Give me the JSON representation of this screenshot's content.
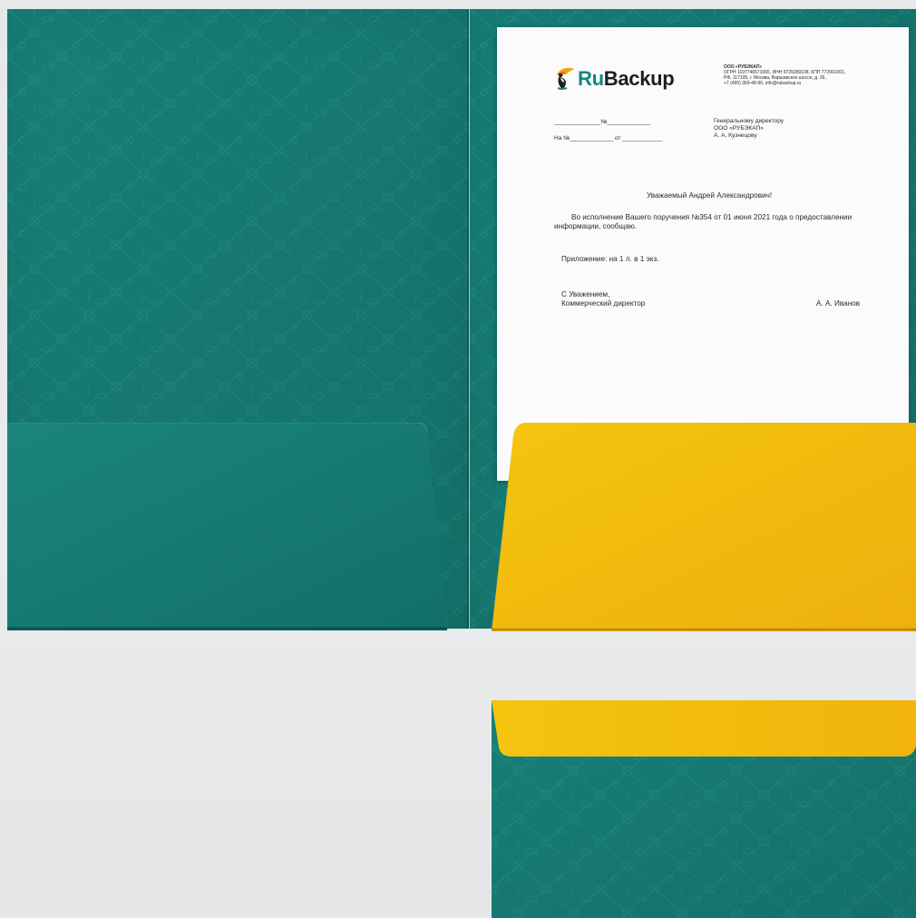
{
  "colors": {
    "teal": "#177f77",
    "teal_dark": "#126c66",
    "yellow": "#f2bb0f",
    "paper": "#fbfbfb"
  },
  "letter": {
    "logo": {
      "ru": "Ru",
      "backup": "Backup",
      "icon": "toucan-logo-icon"
    },
    "company": {
      "name": "ООО «РУБЭКАП»",
      "line1": "ОГРН 1197746571065, ИНН 9729289108, КПП 772901001,",
      "line2": "РФ, 117105, г. Москва, Варшавское шоссе, д. 26,",
      "line3": "+7 (495) 369-48-90, info@rubackup.ru"
    },
    "ref_line1": "______________№_____________",
    "ref_line2": "На №_____________ от ____________",
    "addressee": {
      "line1": "Генеральному директору",
      "line2": "ООО «РУБЭКАП»",
      "line3": "А. А. Кузнецову"
    },
    "salutation": "Уважаемый Андрей Александрович!",
    "body_line1": "Во исполнение Вашего поручения №354 от 01 июня 2021 года о предоставлении",
    "body_line2": "информации, сообщаю.",
    "attachment": "Приложение: на 1 л. в 1 экз.",
    "closing1": "С Уважением,",
    "closing2": "Коммерческий директор",
    "signature_name": "А. А. Иванов"
  }
}
